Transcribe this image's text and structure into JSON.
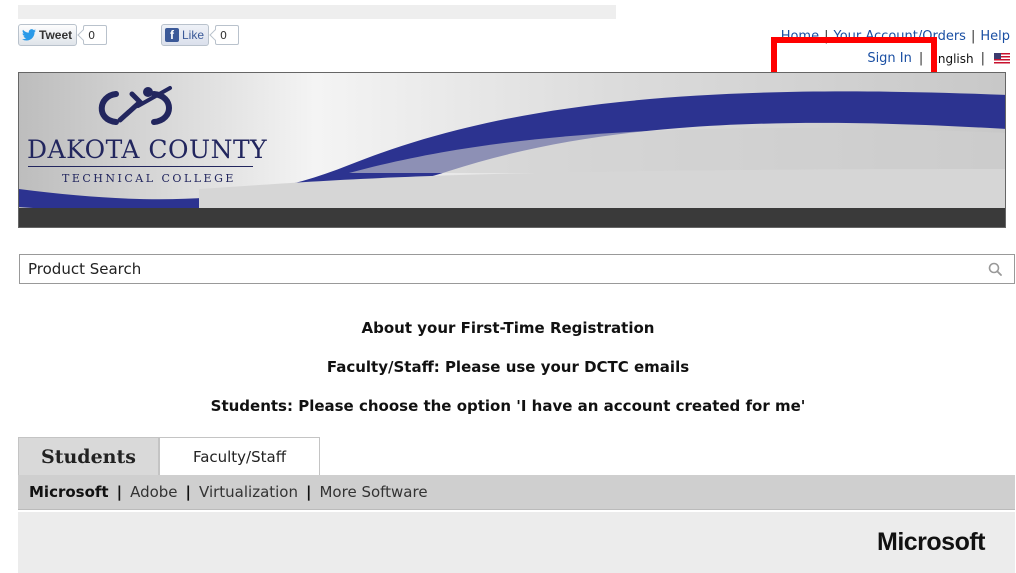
{
  "social": {
    "tweet_label": "Tweet",
    "tweet_count": "0",
    "like_label": "Like",
    "like_count": "0"
  },
  "header": {
    "home": "Home",
    "account_orders": "Your Account/Orders",
    "help": "Help",
    "sign_in": "Sign In",
    "language": "English",
    "flag_icon": "us-flag-icon"
  },
  "banner": {
    "college_name": "DAKOTA COUNTY",
    "college_sub": "TECHNICAL COLLEGE"
  },
  "search": {
    "placeholder": "Product Search",
    "icon": "search-icon"
  },
  "messages": [
    "About your First-Time Registration",
    "Faculty/Staff: Please use your DCTC emails",
    "Students: Please choose the option 'I have an account created for me'"
  ],
  "tabs": [
    {
      "label": "Students",
      "active": true
    },
    {
      "label": "Faculty/Staff",
      "active": false
    }
  ],
  "subnav": [
    {
      "label": "Microsoft",
      "active": true
    },
    {
      "label": "Adobe",
      "active": false
    },
    {
      "label": "Virtualization",
      "active": false
    },
    {
      "label": "More Software",
      "active": false
    }
  ],
  "panel": {
    "title": "Microsoft"
  },
  "colors": {
    "link": "#1a4fa3",
    "banner_wave": "#2c3390",
    "highlight": "#ff0000"
  }
}
